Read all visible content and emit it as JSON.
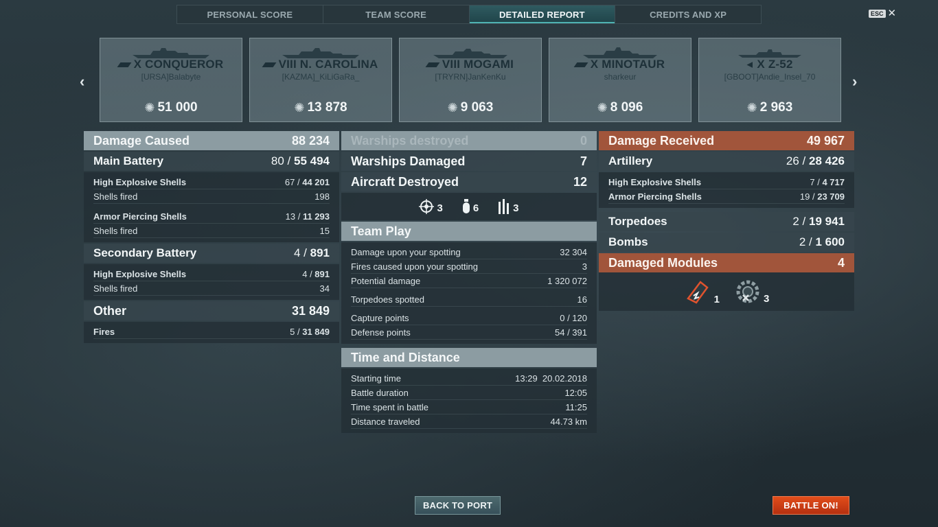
{
  "tabs": [
    "PERSONAL SCORE",
    "TEAM SCORE",
    "DETAILED REPORT",
    "CREDITS AND XP"
  ],
  "active_tab": "DETAILED REPORT",
  "esc_label": "ESC",
  "ships": [
    {
      "name": "X CONQUEROR",
      "player": "[URSA]Balabyte",
      "damage": "51 000"
    },
    {
      "name": "VIII N. CAROLINA",
      "player": "[KAZMA]_KiLiGaRa_",
      "damage": "13 878"
    },
    {
      "name": "VIII MOGAMI",
      "player": "[TRYRN]JanKenKu",
      "damage": "9 063"
    },
    {
      "name": "X MINOTAUR",
      "player": "sharkeur",
      "damage": "8 096"
    },
    {
      "name": "X Z-52",
      "player": "[GBOOT]Andie_Insel_70",
      "damage": "2 963"
    }
  ],
  "left": {
    "damage_caused": {
      "label": "Damage Caused",
      "value": "88 234"
    },
    "main_battery": {
      "label": "Main Battery",
      "hits": "80",
      "sep": " / ",
      "damage": "55 494"
    },
    "mb_he": {
      "label": "High Explosive Shells",
      "hits": "67",
      "sep": " / ",
      "damage": "44 201"
    },
    "mb_he_fired": {
      "label": "Shells fired",
      "value": "198"
    },
    "mb_ap": {
      "label": "Armor Piercing Shells",
      "hits": "13",
      "sep": " / ",
      "damage": "11 293"
    },
    "mb_ap_fired": {
      "label": "Shells fired",
      "value": "15"
    },
    "secondary": {
      "label": "Secondary Battery",
      "hits": "4",
      "sep": " / ",
      "damage": "891"
    },
    "sec_he": {
      "label": "High Explosive Shells",
      "hits": "4",
      "sep": " / ",
      "damage": "891"
    },
    "sec_he_fired": {
      "label": "Shells fired",
      "value": "34"
    },
    "other": {
      "label": "Other",
      "value": "31 849"
    },
    "fires": {
      "label": "Fires",
      "hits": "5",
      "sep": " / ",
      "damage": "31 849"
    }
  },
  "middle": {
    "warships_destroyed": {
      "label": "Warships destroyed",
      "value": "0"
    },
    "warships_damaged": {
      "label": "Warships Damaged",
      "value": "7"
    },
    "aircraft_destroyed": {
      "label": "Aircraft Destroyed",
      "value": "12"
    },
    "icons": {
      "ribbon_main": "3",
      "ribbon_torp": "6",
      "ribbon_ammo": "3"
    },
    "team_play": {
      "label": "Team Play"
    },
    "tp_rows": [
      {
        "label": "Damage upon your spotting",
        "value": "32 304"
      },
      {
        "label": "Fires caused upon your spotting",
        "value": "3"
      },
      {
        "label": "Potential damage",
        "value": "1 320 072"
      },
      {
        "label": "Torpedoes spotted",
        "value": "16"
      },
      {
        "label": "Capture points",
        "value": "0 / 120"
      },
      {
        "label": "Defense points",
        "value": "54 / 391"
      }
    ],
    "time_distance": {
      "label": "Time and Distance"
    },
    "td_rows": [
      {
        "label": "Starting time",
        "value": "13:29  20.02.2018"
      },
      {
        "label": "Battle duration",
        "value": "12:05"
      },
      {
        "label": "Time spent in battle",
        "value": "11:25"
      },
      {
        "label": "Distance traveled",
        "value": "44.73 km"
      }
    ]
  },
  "right": {
    "damage_received": {
      "label": "Damage Received",
      "value": "49 967"
    },
    "artillery": {
      "label": "Artillery",
      "hits": "26",
      "sep": " / ",
      "damage": "28 426"
    },
    "art_he": {
      "label": "High Explosive Shells",
      "hits": "7",
      "sep": " / ",
      "damage": "4 717"
    },
    "art_ap": {
      "label": "Armor Piercing Shells",
      "hits": "19",
      "sep": " / ",
      "damage": "23 709"
    },
    "torpedoes": {
      "label": "Torpedoes",
      "hits": "2",
      "sep": " / ",
      "damage": "19 941"
    },
    "bombs": {
      "label": "Bombs",
      "hits": "2",
      "sep": " / ",
      "damage": "1 600"
    },
    "damaged_modules": {
      "label": "Damaged Modules",
      "value": "4"
    },
    "module_icons": {
      "flood_count": "1",
      "module_count": "3"
    }
  },
  "buttons": {
    "back_to_port": "BACK TO PORT",
    "battle_on": "BATTLE ON!"
  },
  "colors": {
    "accent_tab": "#1f4449",
    "received_header": "#a1553b",
    "battle_button": "#d2411a"
  }
}
